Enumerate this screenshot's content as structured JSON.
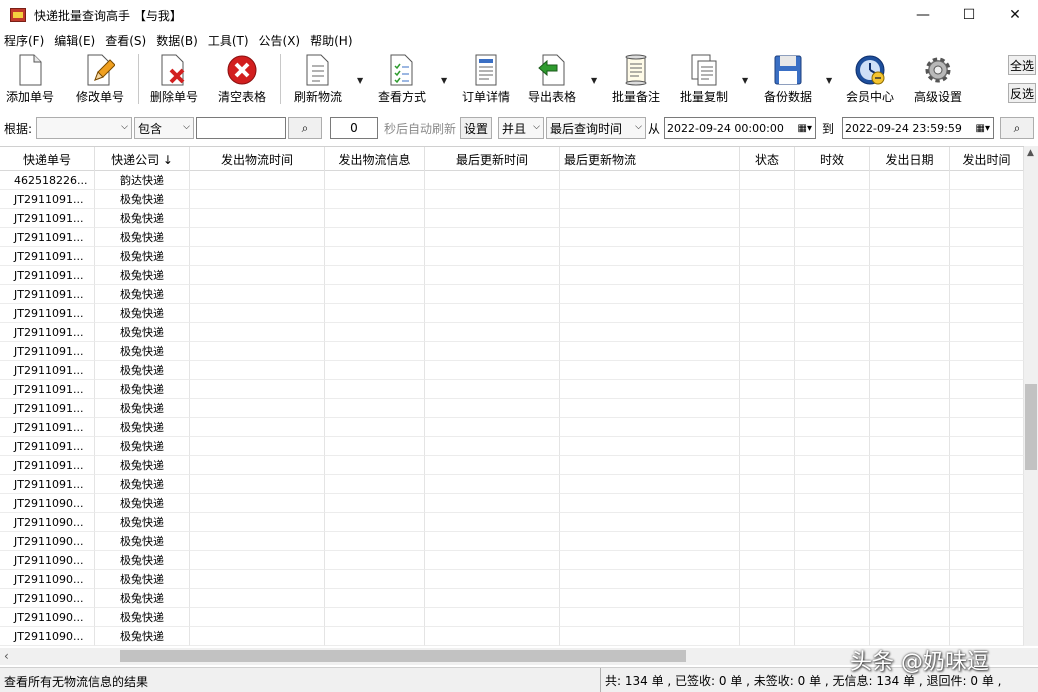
{
  "window": {
    "title": "快递批量查询高手 【与我】",
    "minimize": "—",
    "maximize": "☐",
    "close": "✕"
  },
  "menu": [
    "程序(F)",
    "编辑(E)",
    "查看(S)",
    "数据(B)",
    "工具(T)",
    "公告(X)",
    "帮助(H)"
  ],
  "toolbar": {
    "add": "添加单号",
    "edit": "修改单号",
    "delete": "删除单号",
    "clear": "清空表格",
    "refresh": "刷新物流",
    "view_mode": "查看方式",
    "order_detail": "订单详情",
    "export": "导出表格",
    "batch_note": "批量备注",
    "batch_copy": "批量复制",
    "backup": "备份数据",
    "member": "会员中心",
    "settings": "高级设置",
    "select_all": "全选",
    "invert": "反选"
  },
  "filter": {
    "basis_label": "根据:",
    "basis_value": "",
    "match_value": "包含",
    "keyword": "",
    "search_icon": "⌕",
    "seconds": "0",
    "auto_refresh_label": "秒后自动刷新",
    "set_button": "设置",
    "logic_value": "并且",
    "time_field_value": "最后查询时间",
    "from_label": "从",
    "from_value": "2022-09-24 00:00:00",
    "to_label": "到",
    "to_value": "2022-09-24 23:59:59"
  },
  "table": {
    "columns": [
      "快递单号",
      "快递公司 ↓",
      "发出物流时间",
      "发出物流信息",
      "最后更新时间",
      "最后更新物流",
      "状态",
      "时效",
      "发出日期",
      "发出时间"
    ],
    "rows": [
      [
        "462518226...",
        "韵达快递"
      ],
      [
        "JT2911091...",
        "极兔快递"
      ],
      [
        "JT2911091...",
        "极兔快递"
      ],
      [
        "JT2911091...",
        "极兔快递"
      ],
      [
        "JT2911091...",
        "极兔快递"
      ],
      [
        "JT2911091...",
        "极兔快递"
      ],
      [
        "JT2911091...",
        "极兔快递"
      ],
      [
        "JT2911091...",
        "极兔快递"
      ],
      [
        "JT2911091...",
        "极兔快递"
      ],
      [
        "JT2911091...",
        "极兔快递"
      ],
      [
        "JT2911091...",
        "极兔快递"
      ],
      [
        "JT2911091...",
        "极兔快递"
      ],
      [
        "JT2911091...",
        "极兔快递"
      ],
      [
        "JT2911091...",
        "极兔快递"
      ],
      [
        "JT2911091...",
        "极兔快递"
      ],
      [
        "JT2911091...",
        "极兔快递"
      ],
      [
        "JT2911091...",
        "极兔快递"
      ],
      [
        "JT2911090...",
        "极兔快递"
      ],
      [
        "JT2911090...",
        "极兔快递"
      ],
      [
        "JT2911090...",
        "极兔快递"
      ],
      [
        "JT2911090...",
        "极兔快递"
      ],
      [
        "JT2911090...",
        "极兔快递"
      ],
      [
        "JT2911090...",
        "极兔快递"
      ],
      [
        "JT2911090...",
        "极兔快递"
      ],
      [
        "JT2911090...",
        "极兔快递"
      ]
    ]
  },
  "status": {
    "left": "查看所有无物流信息的结果",
    "right": "共: 134 单 , 已签收: 0 单 , 未签收: 0 单 , 无信息: 134 单 , 退回件: 0 单 ,"
  },
  "watermark": "头条 @奶味逗",
  "colors": {
    "delete_red": "#d21f1f",
    "export_green": "#2e9b2e",
    "member_blue": "#1e4f9c"
  }
}
